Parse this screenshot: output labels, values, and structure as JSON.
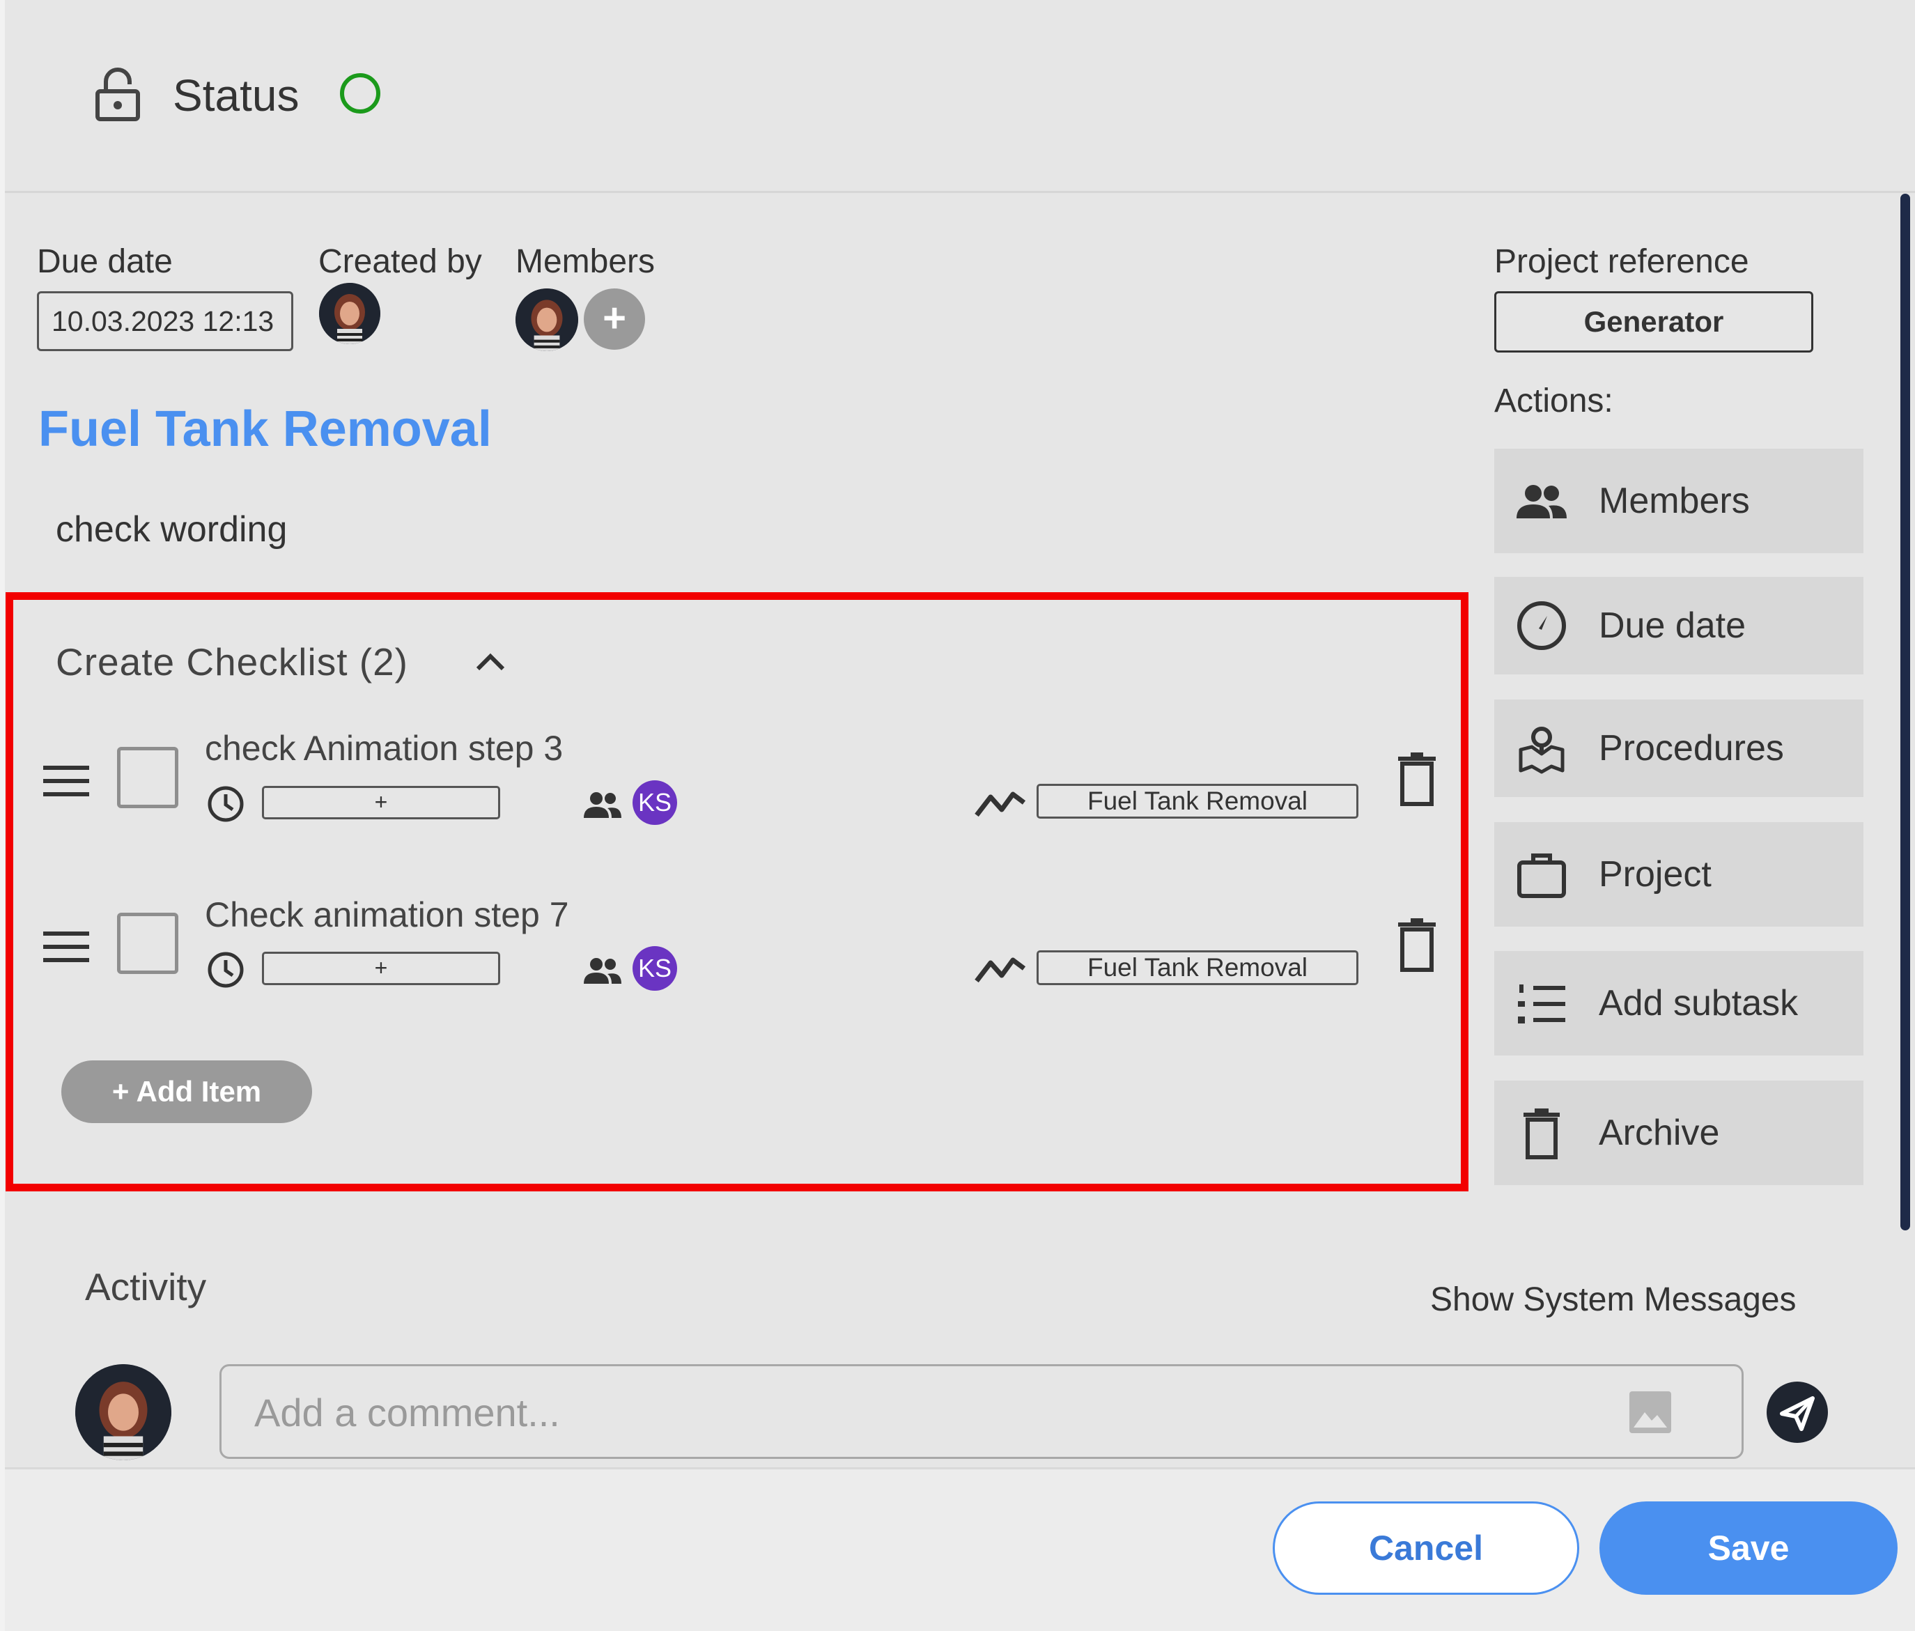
{
  "header": {
    "status_label": "Status",
    "status_color": "#1b9a1b"
  },
  "meta": {
    "due_date_label": "Due date",
    "due_date_value": "10.03.2023 12:13",
    "created_by_label": "Created by",
    "members_label": "Members",
    "add_member_symbol": "+"
  },
  "task": {
    "title": "Fuel Tank Removal",
    "description": "check wording"
  },
  "checklist": {
    "title": "Create Checklist (2)",
    "items": [
      {
        "label": "check Animation step 3",
        "time_value": "+",
        "assignee_initials": "KS",
        "reference": "Fuel Tank Removal",
        "checked": false
      },
      {
        "label": "Check animation step 7",
        "time_value": "+",
        "assignee_initials": "KS",
        "reference": "Fuel Tank Removal",
        "checked": false
      }
    ],
    "add_item_label": "+ Add Item"
  },
  "sidebar": {
    "project_reference_label": "Project reference",
    "project_reference_value": "Generator",
    "actions_label": "Actions:",
    "actions": [
      {
        "label": "Members",
        "icon": "group-icon"
      },
      {
        "label": "Due date",
        "icon": "compass-icon"
      },
      {
        "label": "Procedures",
        "icon": "map-marker-icon"
      },
      {
        "label": "Project",
        "icon": "briefcase-icon"
      },
      {
        "label": "Add subtask",
        "icon": "numbered-list-icon"
      },
      {
        "label": "Archive",
        "icon": "trash-icon"
      }
    ]
  },
  "activity": {
    "title": "Activity",
    "show_system_messages": "Show System Messages",
    "comment_placeholder": "Add a comment..."
  },
  "footer": {
    "cancel_label": "Cancel",
    "save_label": "Save"
  },
  "colors": {
    "accent": "#4a90f0",
    "highlight": "#f20000",
    "assignee_badge": "#6a34c2"
  }
}
